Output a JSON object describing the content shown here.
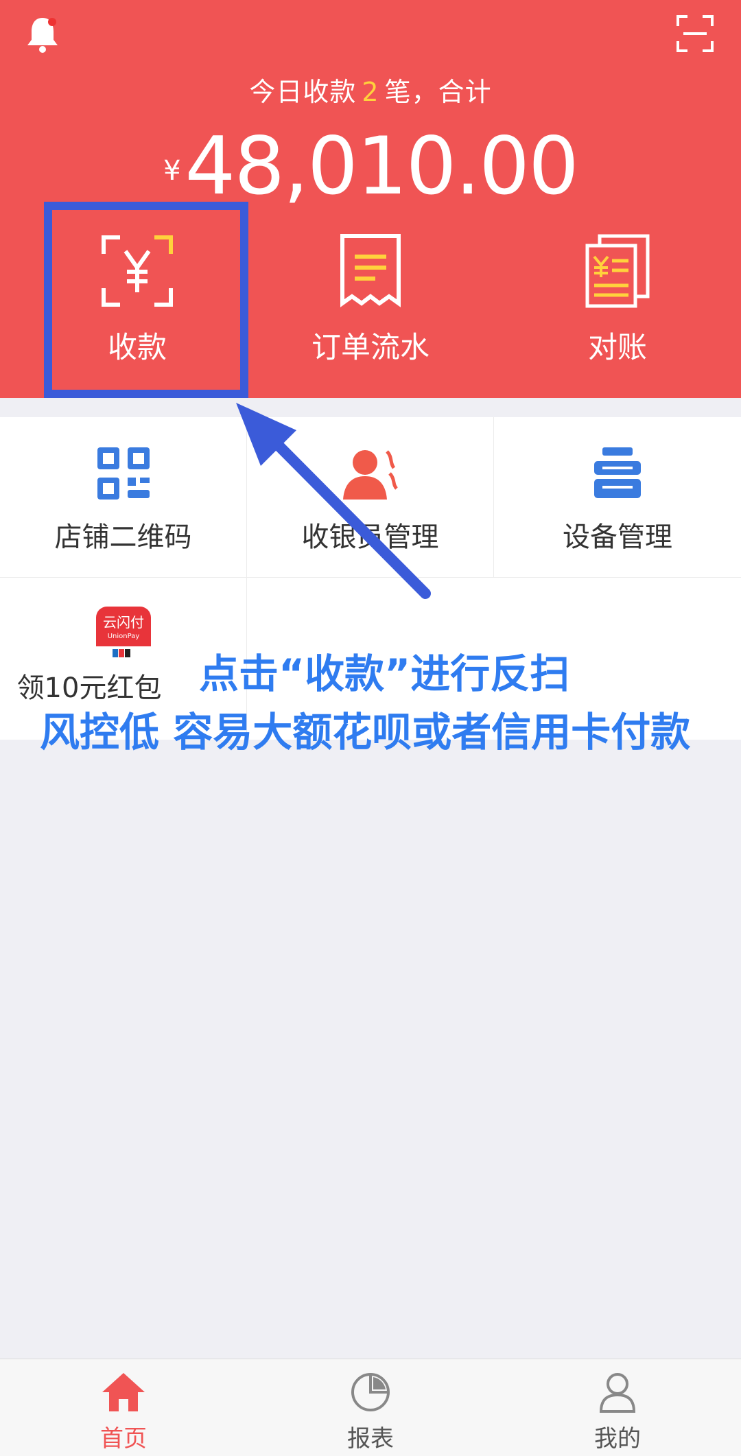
{
  "header": {
    "summary_prefix": "今日收款",
    "summary_count": "2",
    "summary_suffix": "笔，合计",
    "currency": "¥",
    "amount": "48,010.00",
    "accent_color": "#f05454",
    "count_color": "#ffd23c",
    "bell_icon": "bell-icon",
    "scan_icon": "scan-icon"
  },
  "actions": [
    {
      "label": "收款",
      "icon": "yuan-scan-icon"
    },
    {
      "label": "订单流水",
      "icon": "receipt-icon"
    },
    {
      "label": "对账",
      "icon": "reconcile-icon"
    }
  ],
  "grid": [
    {
      "label": "店铺二维码",
      "icon": "qrcode-icon"
    },
    {
      "label": "收银员管理",
      "icon": "cashier-icon"
    },
    {
      "label": "设备管理",
      "icon": "device-icon"
    },
    {
      "label": "领10元红包",
      "icon": "unionpay-icon",
      "badge_text": "云闪付",
      "badge_sub": "UnionPay"
    }
  ],
  "annotation": {
    "line1": "点击“收款”进行反扫",
    "line2": "风控低 容易大额花呗或者信用卡付款",
    "color": "#2f7cf0",
    "box_color": "#3b5bd9"
  },
  "tabs": [
    {
      "label": "首页",
      "icon": "home-icon",
      "active": true
    },
    {
      "label": "报表",
      "icon": "pie-chart-icon",
      "active": false
    },
    {
      "label": "我的",
      "icon": "user-icon",
      "active": false
    }
  ]
}
